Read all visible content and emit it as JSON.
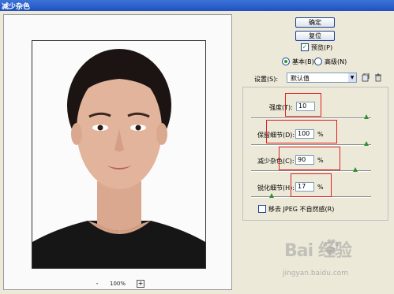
{
  "window": {
    "title": "减少杂色"
  },
  "preview": {
    "zoom_minus": "-",
    "zoom_value": "100%",
    "zoom_plus": "+"
  },
  "buttons": {
    "ok": "确定",
    "reset": "复位"
  },
  "preview_toggle": {
    "label": "预览(P)",
    "checked": true
  },
  "mode": {
    "basic": "基本(B)",
    "advanced": "高级(N)",
    "selected": "basic"
  },
  "settings": {
    "label": "设置(S):",
    "value": "默认值"
  },
  "params": [
    {
      "label": "强度(T):",
      "value": "10",
      "unit": "",
      "slider": 0.96
    },
    {
      "label": "保留细节(D):",
      "value": "100",
      "unit": "%",
      "slider": 0.96
    },
    {
      "label": "减少杂色(C):",
      "value": "90",
      "unit": "%",
      "slider": 0.87
    },
    {
      "label": "锐化细节(H):",
      "value": "17",
      "unit": "%",
      "slider": 0.17
    }
  ],
  "jpeg": {
    "label": "移去 JPEG 不自然感(R)",
    "checked": false
  },
  "watermark": {
    "logo": "Bai 经验",
    "url": "jingyan.baidu.com"
  },
  "colors": {
    "accent_green": "#2f8f2f",
    "highlight_red": "#e02020",
    "titlebar": "#2a5fcc"
  }
}
